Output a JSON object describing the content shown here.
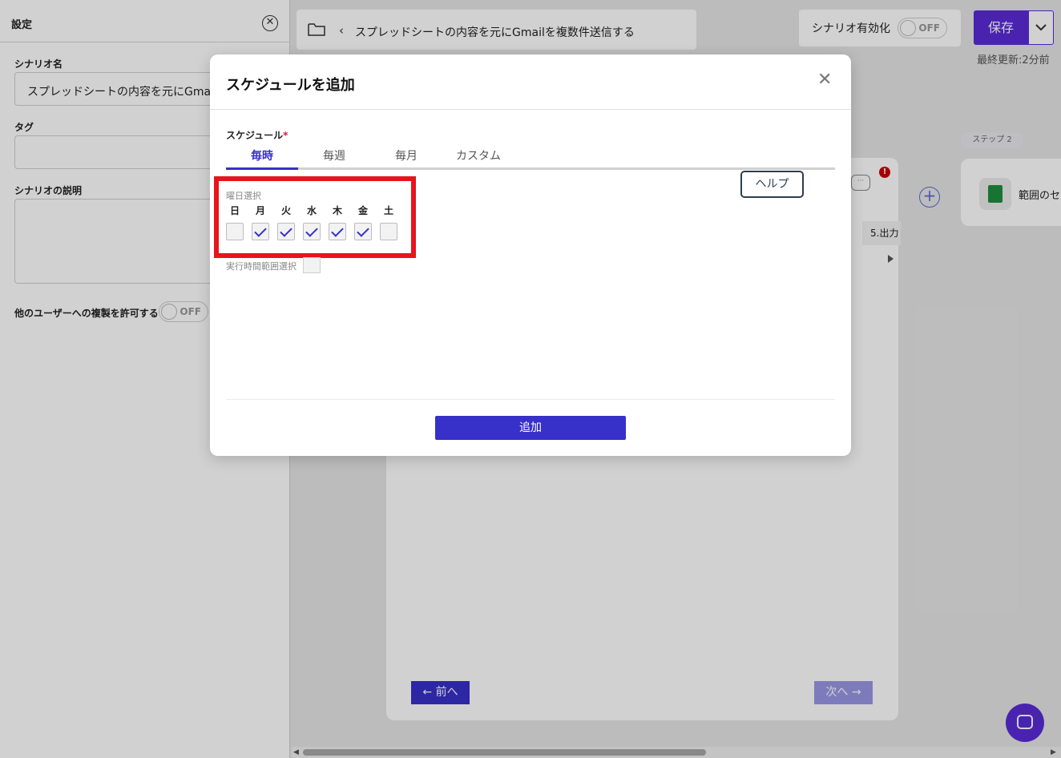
{
  "settings_panel": {
    "title": "設定",
    "scenario_name_label": "シナリオ名",
    "scenario_name_value": "スプレッドシートの内容を元にGmail",
    "tag_label": "タグ",
    "description_label": "シナリオの説明",
    "allow_copy_label": "他のユーザーへの複製を許可する",
    "allow_copy_toggle": "OFF"
  },
  "topbar": {
    "breadcrumb_text": "スプレッドシートの内容を元にGmailを複数件送信する",
    "enable_label": "シナリオ有効化",
    "enable_toggle": "OFF",
    "save_label": "保存",
    "last_updated": "最終更新:2分前"
  },
  "canvas": {
    "step_badge": "ステップ 2",
    "step_card_text": "範囲のセ",
    "output_tab": "5.出力",
    "prev_label": "← 前へ",
    "next_label": "次へ →"
  },
  "modal": {
    "title": "スケジュールを追加",
    "schedule_label": "スケジュール",
    "required_mark": "*",
    "tabs": [
      {
        "label": "毎時",
        "active": true
      },
      {
        "label": "毎週",
        "active": false
      },
      {
        "label": "毎月",
        "active": false
      },
      {
        "label": "カスタム",
        "active": false
      }
    ],
    "help_label": "ヘルプ",
    "weekday_title": "曜日選択",
    "weekdays": [
      {
        "label": "日",
        "checked": false
      },
      {
        "label": "月",
        "checked": true
      },
      {
        "label": "火",
        "checked": true
      },
      {
        "label": "水",
        "checked": true
      },
      {
        "label": "木",
        "checked": true
      },
      {
        "label": "金",
        "checked": true
      },
      {
        "label": "土",
        "checked": false
      }
    ],
    "time_range_label": "実行時間範囲選択",
    "add_label": "追加"
  },
  "colors": {
    "accent": "#3730c9",
    "save": "#5a2bd6",
    "highlight": "#e8141c"
  }
}
